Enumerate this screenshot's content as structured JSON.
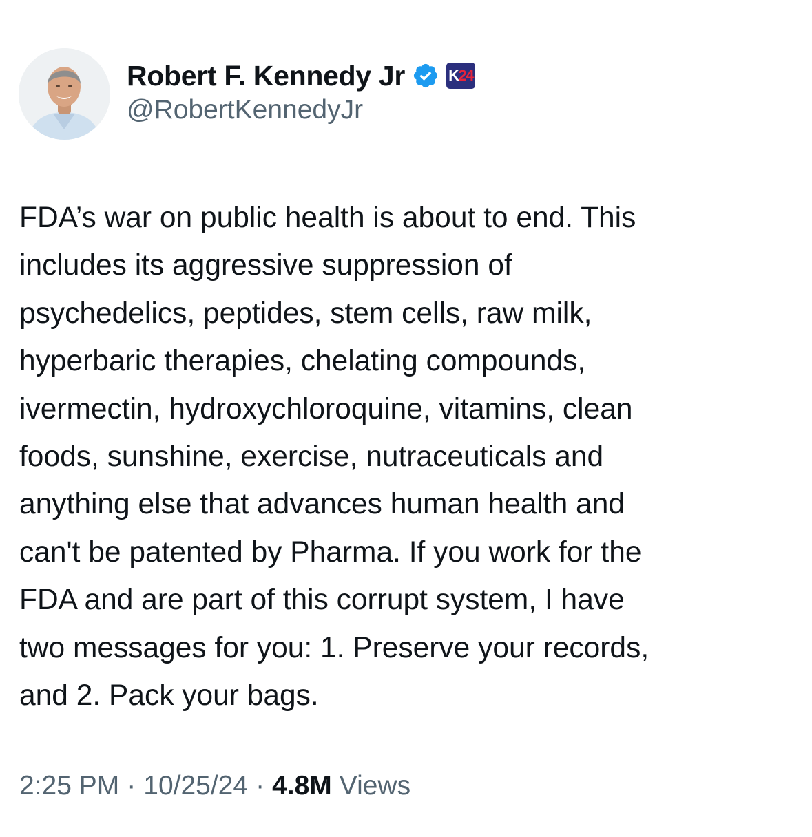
{
  "author": {
    "display_name": "Robert F. Kennedy Jr",
    "handle": "@RobertKennedyJr",
    "verified": true,
    "affiliate_badge": {
      "text_left": "K",
      "text_right": "24"
    }
  },
  "tweet": {
    "lines": [
      "FDA’s war on public health is about to end. This",
      "includes its aggressive suppression of",
      "psychedelics, peptides, stem cells, raw milk,",
      "hyperbaric therapies, chelating compounds,",
      "ivermectin, hydroxychloroquine, vitamins, clean",
      "foods, sunshine, exercise, nutraceuticals and",
      "anything else that advances human health and",
      "can't be patented by Pharma. If you work for the",
      "FDA and are part of this corrupt system, I have",
      "two messages for you: 1. Preserve your records,",
      "and 2. Pack your bags."
    ]
  },
  "meta": {
    "time": "2:25 PM",
    "separator": "·",
    "date": "10/25/24",
    "views_count": "4.8M",
    "views_label": "Views"
  },
  "colors": {
    "text_primary": "#0f1419",
    "text_secondary": "#536471",
    "verified_blue": "#1d9bf0",
    "badge_navy": "#2b2f7d",
    "badge_red": "#e5243b"
  },
  "icons": {
    "verified": "verified-checkmark-icon",
    "affiliate": "affiliate-badge-icon"
  }
}
